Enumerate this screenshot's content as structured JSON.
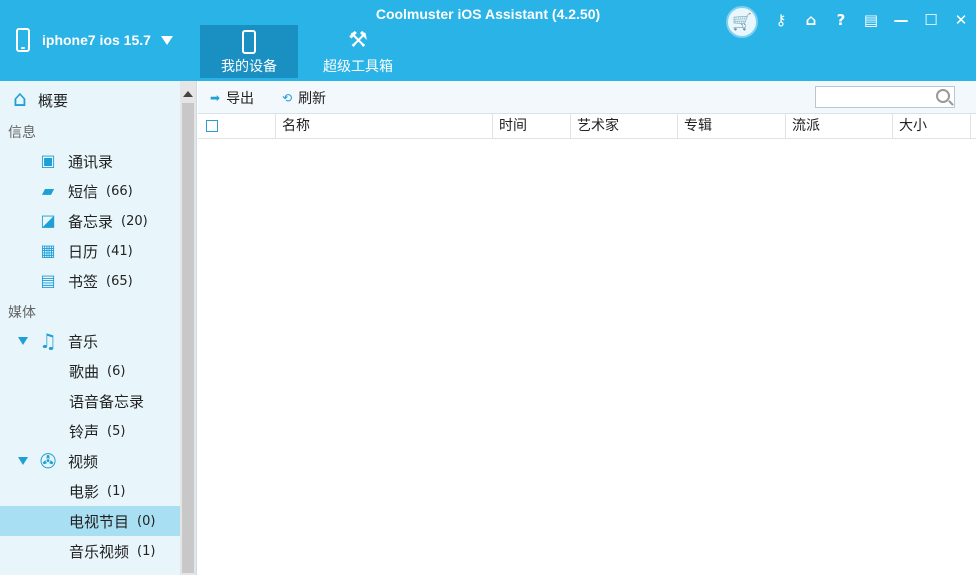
{
  "app": {
    "title": "Coolmuster iOS Assistant (4.2.50)"
  },
  "device": {
    "name": "iphone7 ios 15.7"
  },
  "nav_tabs": [
    {
      "label": "我的设备",
      "icon": "phone-icon",
      "active": true
    },
    {
      "label": "超级工具箱",
      "icon": "tools-icon",
      "active": false
    }
  ],
  "window_controls": [
    {
      "name": "cart-icon",
      "glyph": "🛒"
    },
    {
      "name": "key-icon",
      "glyph": "🔑"
    },
    {
      "name": "home-icon",
      "glyph": "⌂"
    },
    {
      "name": "help-icon",
      "glyph": "?"
    },
    {
      "name": "feedback-icon",
      "glyph": "▤"
    },
    {
      "name": "minimize-icon",
      "glyph": "—"
    },
    {
      "name": "maximize-icon",
      "glyph": "☐"
    },
    {
      "name": "close-icon",
      "glyph": "✕"
    }
  ],
  "sidebar": {
    "home_label": "概要",
    "info_header": "信息",
    "media_header": "媒体",
    "info_items": [
      {
        "label": "通讯录",
        "count": ""
      },
      {
        "label": "短信",
        "count": "(66)"
      },
      {
        "label": "备忘录",
        "count": "(20)"
      },
      {
        "label": "日历",
        "count": "(41)"
      },
      {
        "label": "书签",
        "count": "(65)"
      }
    ],
    "music": {
      "label": "音乐",
      "children": [
        {
          "label": "歌曲",
          "count": "(6)"
        },
        {
          "label": "语音备忘录",
          "count": ""
        },
        {
          "label": "铃声",
          "count": "(5)"
        }
      ]
    },
    "video": {
      "label": "视频",
      "children": [
        {
          "label": "电影",
          "count": "(1)"
        },
        {
          "label": "电视节目",
          "count": "(0)",
          "active": true
        },
        {
          "label": "音乐视频",
          "count": "(1)"
        }
      ]
    }
  },
  "toolbar": {
    "export_label": "导出",
    "refresh_label": "刷新",
    "search_placeholder": ""
  },
  "table": {
    "columns": [
      "名称",
      "时间",
      "艺术家",
      "专辑",
      "流派",
      "大小"
    ]
  },
  "colors": {
    "accent": "#29b3e6",
    "sidebar_bg": "#e8f6fb",
    "selected": "#a9dff3"
  }
}
